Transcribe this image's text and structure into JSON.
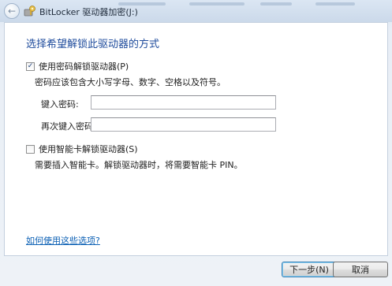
{
  "window": {
    "title": "BitLocker 驱动器加密(J:)"
  },
  "heading": "选择希望解锁此驱动器的方式",
  "password_option": {
    "label": "使用密码解锁驱动器(P)",
    "checked": true,
    "description": "密码应该包含大小写字母、数字、空格以及符号。",
    "enter_label": "键入密码:",
    "enter_value": "",
    "reenter_label": "再次键入密码:",
    "reenter_value": ""
  },
  "smartcard_option": {
    "label": "使用智能卡解锁驱动器(S)",
    "checked": false,
    "description": "需要插入智能卡。解锁驱动器时，将需要智能卡 PIN。"
  },
  "help_link": "如何使用这些选项?",
  "buttons": {
    "next": "下一步(N)",
    "cancel": "取消"
  },
  "icons": {
    "back": "back-arrow-icon",
    "app": "bitlocker-key-icon",
    "checkmark": "checkmark-icon"
  },
  "colors": {
    "heading": "#1e4b9c",
    "link": "#0a5fb4"
  }
}
